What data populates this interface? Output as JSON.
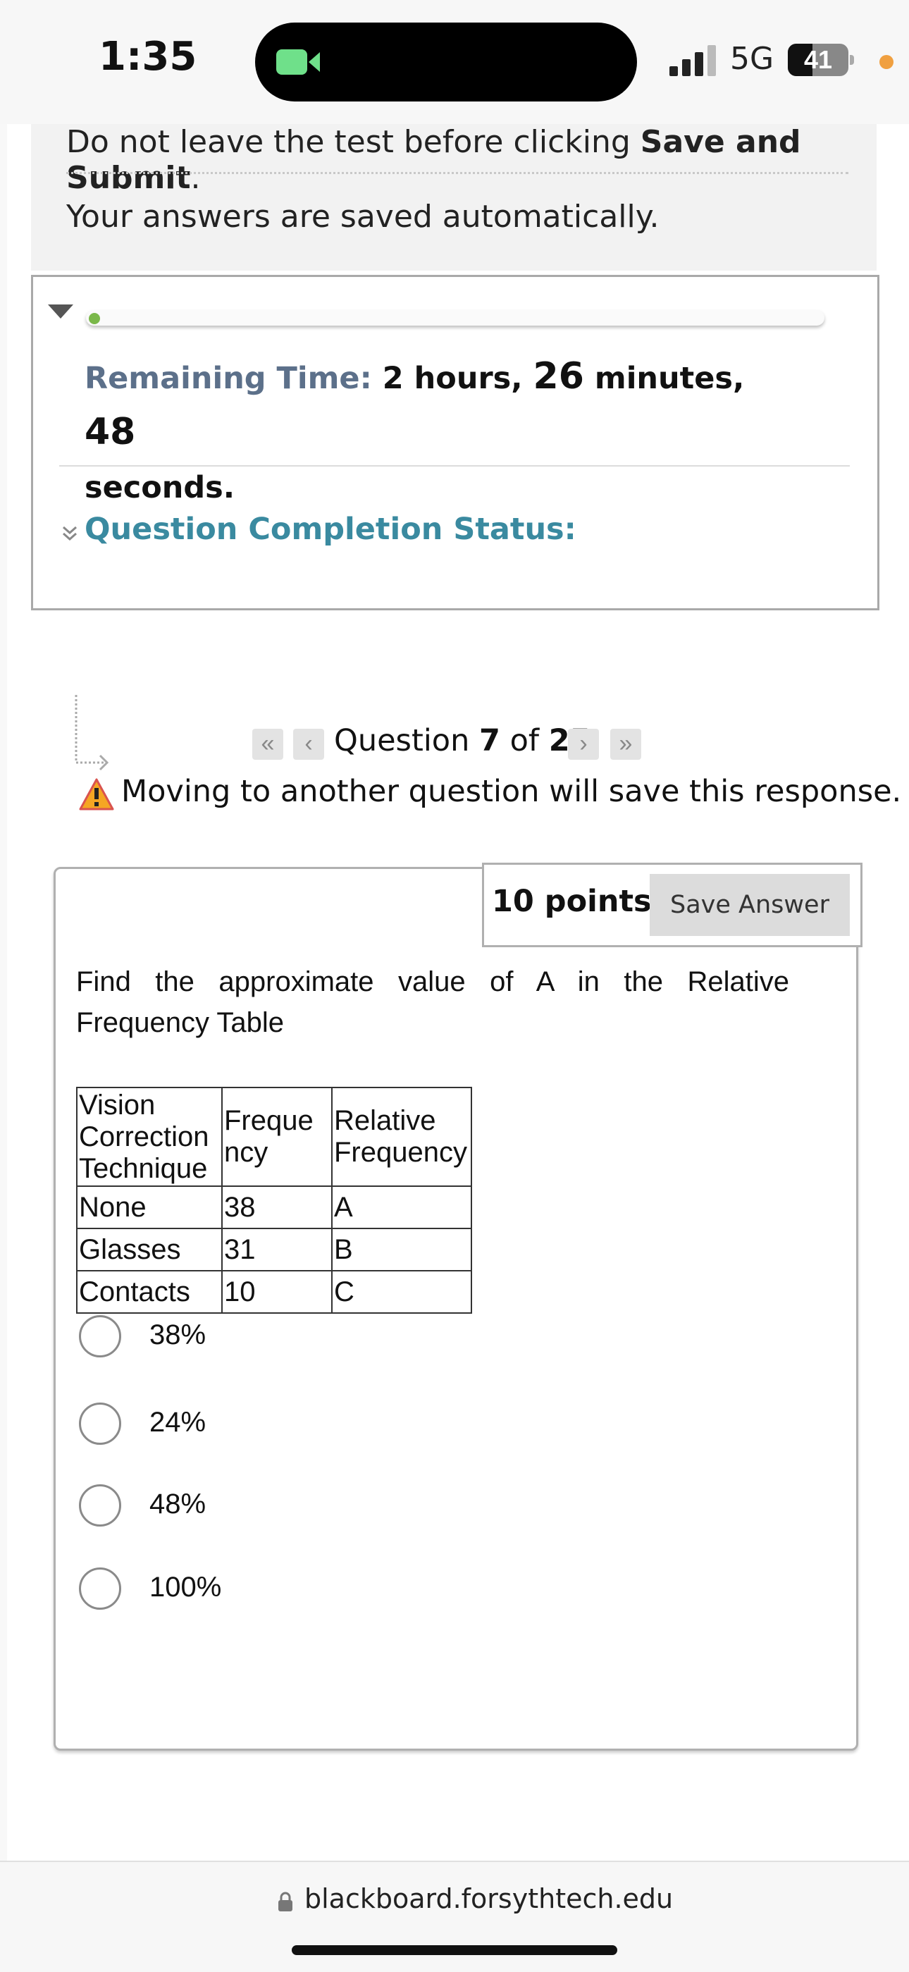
{
  "status_bar": {
    "time": "1:35",
    "network": "5G",
    "battery": "41",
    "battery_level": 0.41
  },
  "test_notes": {
    "note1_prefix": "Do not leave the test before clicking ",
    "note1_bold": "Save and Submit",
    "note1_suffix": ".",
    "note2": "Your answers are saved automatically."
  },
  "timer": {
    "label": "Remaining Time:",
    "hours": "2",
    "hours_unit": " hours, ",
    "minutes": "26",
    "minutes_unit": " minutes, ",
    "seconds": "48",
    "seconds_unit": "seconds."
  },
  "completion_status": {
    "label": "Question Completion Status:"
  },
  "question_nav": {
    "prefix": "Question ",
    "current": "7",
    "of": " of ",
    "total": "25",
    "first_glyph": "«",
    "prev_glyph": "‹",
    "next_glyph": "›",
    "last_glyph": "»",
    "warning": "Moving to another question will save this response."
  },
  "question": {
    "points": "10 points",
    "save_label": "Save Answer",
    "text_line1": "Find the approximate value of A in the Relative",
    "text_line2": "Frequency Table",
    "table": {
      "headers": [
        "Vision Correction Technique",
        "Freque ncy",
        "Relative Frequency"
      ],
      "header_lines": [
        [
          "Vision",
          "Correction",
          "Technique"
        ],
        [
          "Freque",
          "ncy"
        ],
        [
          "Relative",
          "Frequency"
        ]
      ],
      "rows": [
        [
          "None",
          "38",
          "A"
        ],
        [
          "Glasses",
          "31",
          "B"
        ],
        [
          "Contacts",
          "10",
          "C"
        ]
      ]
    },
    "options": [
      "38%",
      "24%",
      "48%",
      "100%"
    ]
  },
  "browser": {
    "url": "blackboard.forsythtech.edu"
  },
  "colors": {
    "label_blue_gray": "#5c708a",
    "status_teal": "#3a8aa0",
    "progress_green": "#7ab84a"
  },
  "icons": [
    "video-camera-icon",
    "signal-icon",
    "collapse-triangle-icon",
    "double-chevron-icon",
    "warning-icon",
    "lock-icon"
  ]
}
